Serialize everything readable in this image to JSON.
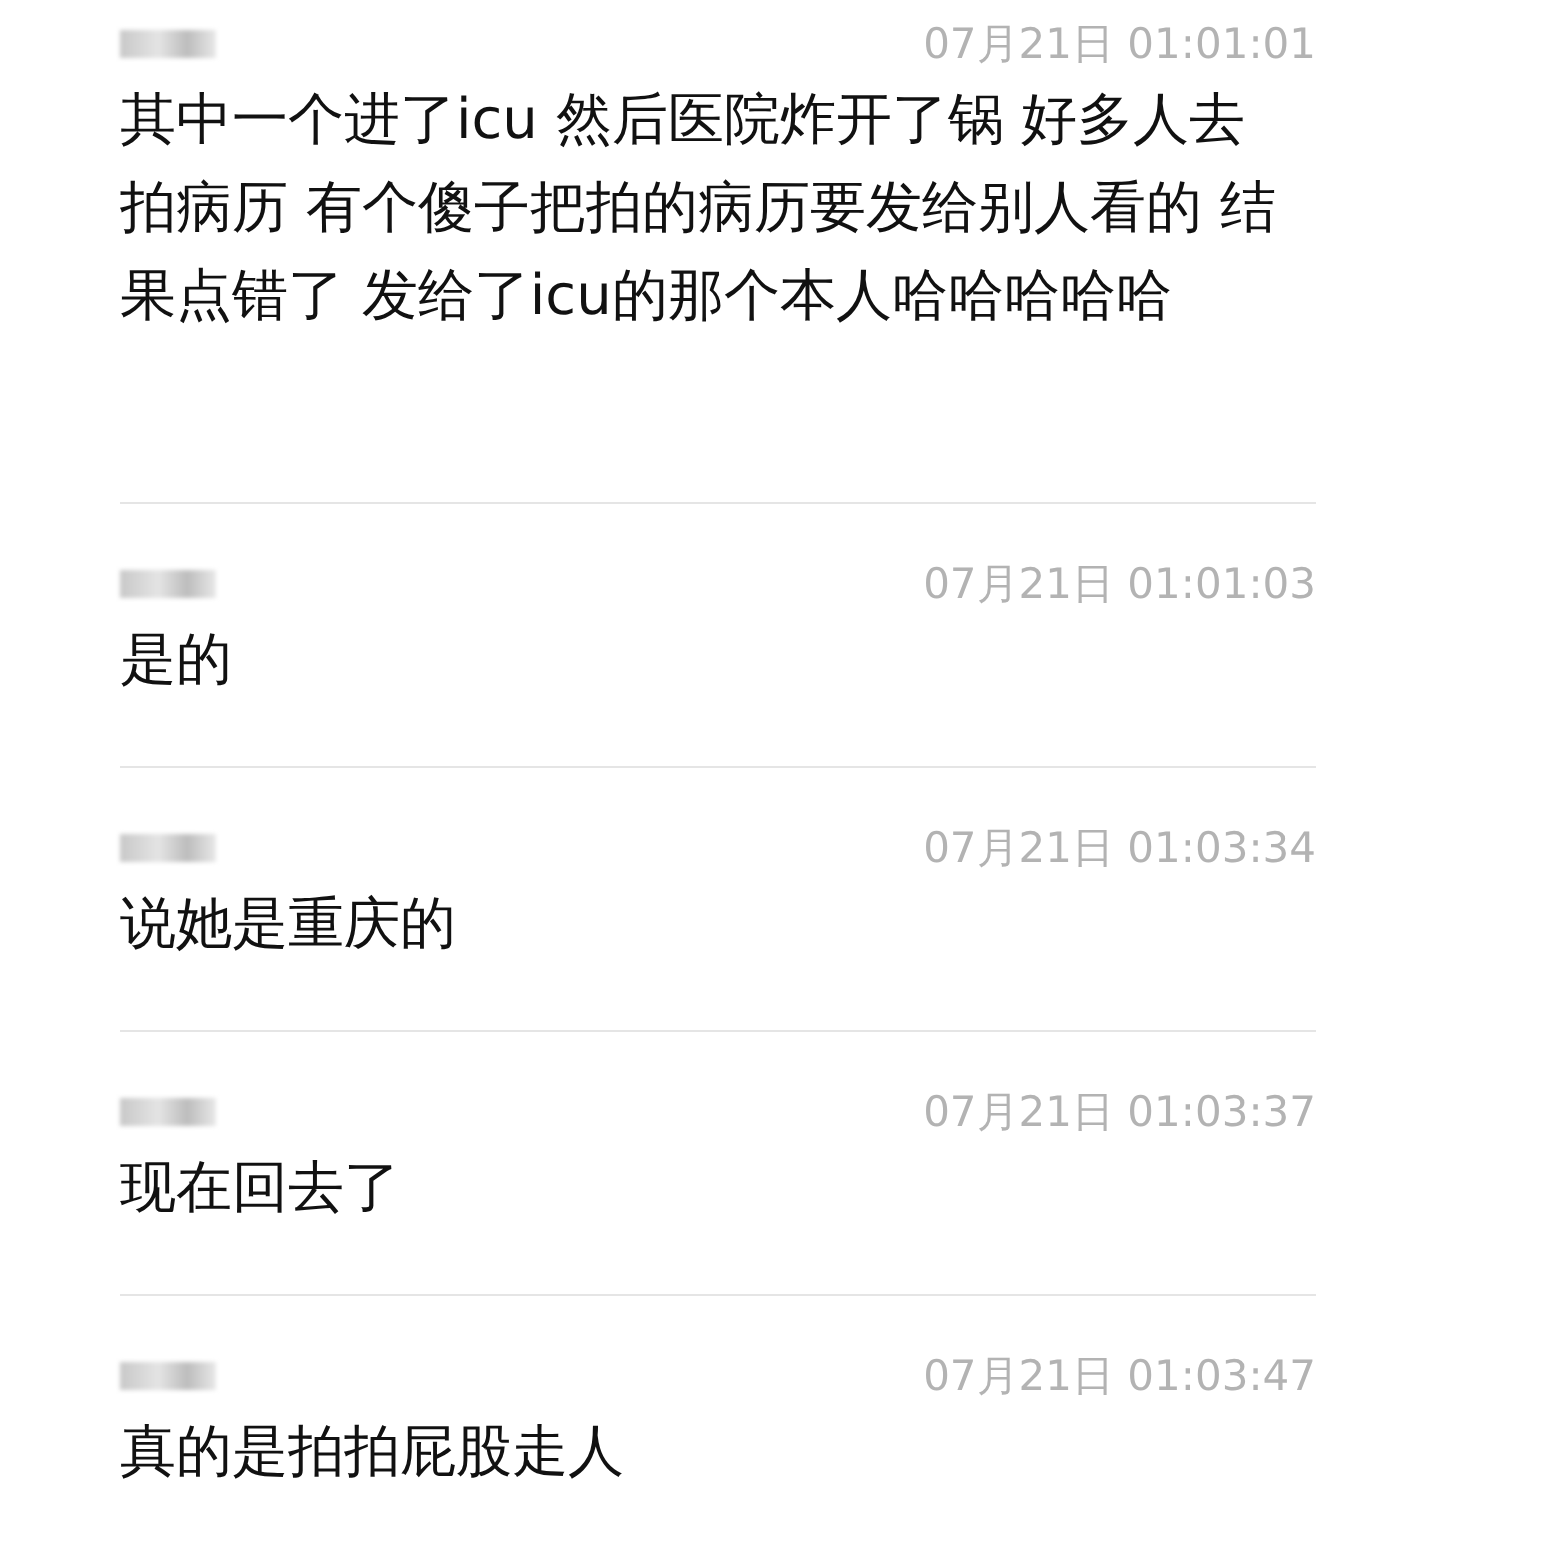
{
  "messages": [
    {
      "time": "07月21日 01:01:01",
      "text": "其中一个进了icu 然后医院炸开了锅 好多人去拍病历 有个傻子把拍的病历要发给别人看的 结果点错了 发给了icu的那个本人哈哈哈哈哈"
    },
    {
      "time": "07月21日 01:01:03",
      "text": "是的"
    },
    {
      "time": "07月21日 01:03:34",
      "text": "说她是重庆的"
    },
    {
      "time": "07月21日 01:03:37",
      "text": "现在回去了"
    },
    {
      "time": "07月21日 01:03:47",
      "text": "真的是拍拍屁股走人"
    }
  ]
}
